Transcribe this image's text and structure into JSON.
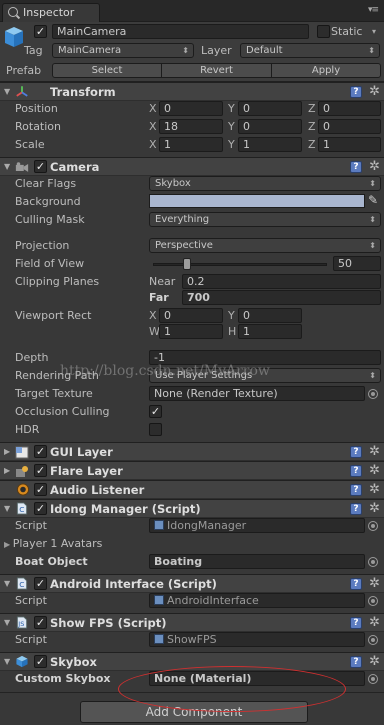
{
  "window": {
    "tab_title": "Inspector"
  },
  "gameobject": {
    "name": "MainCamera",
    "static_label": "Static",
    "tag_label": "Tag",
    "tag_value": "MainCamera",
    "layer_label": "Layer",
    "layer_value": "Default",
    "prefab_label": "Prefab",
    "prefab_select": "Select",
    "prefab_revert": "Revert",
    "prefab_apply": "Apply"
  },
  "transform": {
    "title": "Transform",
    "position_label": "Position",
    "rotation_label": "Rotation",
    "scale_label": "Scale",
    "position": {
      "x": "0",
      "y": "0",
      "z": "0"
    },
    "rotation": {
      "x": "18",
      "y": "0",
      "z": "0"
    },
    "scale": {
      "x": "1",
      "y": "1",
      "z": "1"
    }
  },
  "axes": {
    "x": "X",
    "y": "Y",
    "z": "Z",
    "w": "W",
    "h": "H"
  },
  "camera": {
    "title": "Camera",
    "clear_flags_label": "Clear Flags",
    "clear_flags_value": "Skybox",
    "background_label": "Background",
    "background_color": "#a9b6cf",
    "culling_mask_label": "Culling Mask",
    "culling_mask_value": "Everything",
    "projection_label": "Projection",
    "projection_value": "Perspective",
    "fov_label": "Field of View",
    "fov_value": "50",
    "fov_fraction": 0.97,
    "clipping_label": "Clipping Planes",
    "near_label": "Near",
    "near_value": "0.2",
    "far_label": "Far",
    "far_value": "700",
    "viewport_label": "Viewport Rect",
    "viewport": {
      "x": "0",
      "y": "0",
      "w": "1",
      "h": "1"
    },
    "depth_label": "Depth",
    "depth_value": "-1",
    "rendering_path_label": "Rendering Path",
    "rendering_path_value": "Use Player Settings",
    "target_texture_label": "Target Texture",
    "target_texture_value": "None (Render Texture)",
    "occlusion_label": "Occlusion Culling",
    "hdr_label": "HDR"
  },
  "watermark": "http://blog.csdn.net/MyArrow",
  "components": {
    "gui_layer": "GUI Layer",
    "flare_layer": "Flare Layer",
    "audio_listener": "Audio Listener"
  },
  "idong": {
    "title": "Idong Manager (Script)",
    "script_label": "Script",
    "script_value": "IdongManager",
    "avatars_label": "Player 1 Avatars",
    "boat_label": "Boat Object",
    "boat_value": "Boating"
  },
  "android": {
    "title": "Android Interface (Script)",
    "script_label": "Script",
    "script_value": "AndroidInterface"
  },
  "fps": {
    "title": "Show FPS (Script)",
    "script_label": "Script",
    "script_value": "ShowFPS"
  },
  "skybox": {
    "title": "Skybox",
    "custom_label": "Custom Skybox",
    "custom_value": "None (Material)"
  },
  "add_component": "Add Component",
  "colors": {
    "background": "#383838",
    "header": "#424242",
    "help_blue": "#5b7bbf",
    "annotation_red": "#d03030"
  }
}
